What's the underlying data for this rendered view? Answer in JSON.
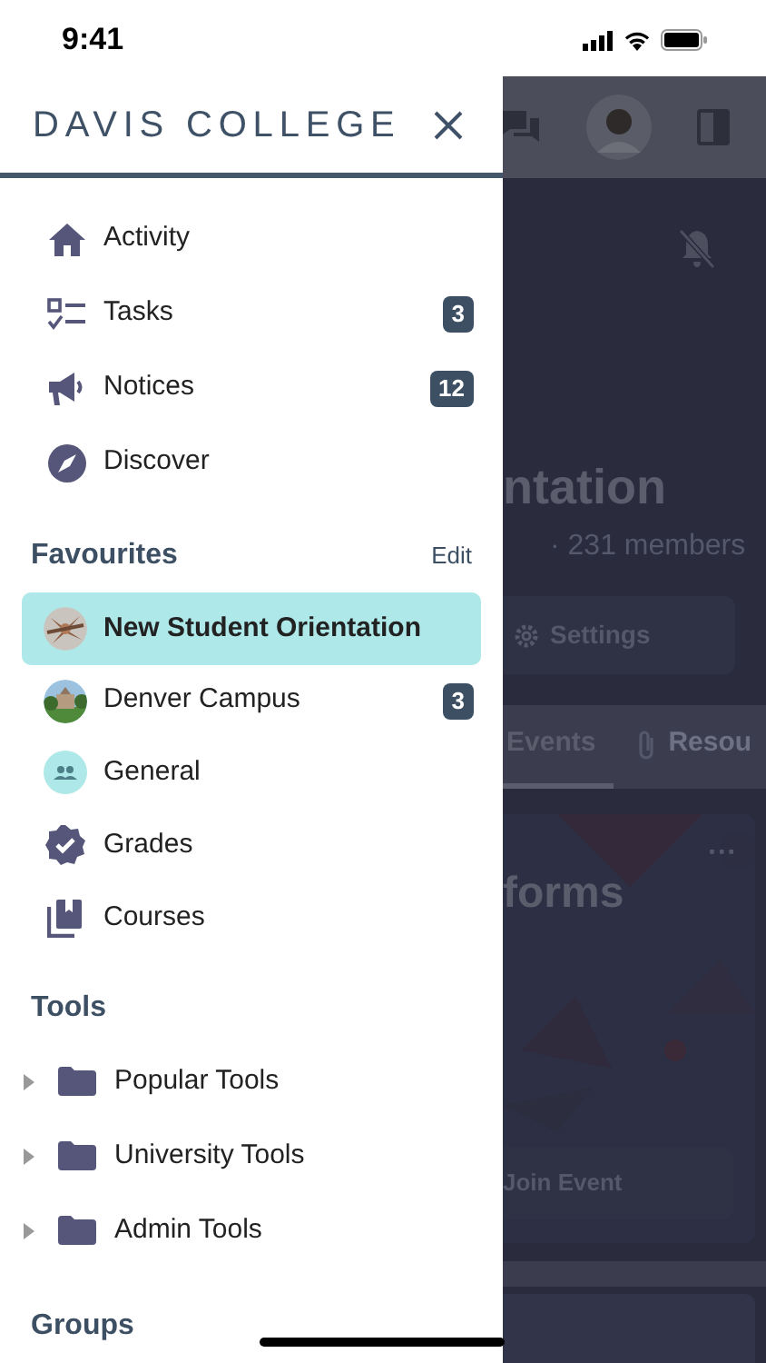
{
  "status_bar": {
    "time": "9:41"
  },
  "drawer": {
    "title": "DAVIS COLLEGE",
    "nav_items": [
      {
        "label": "Activity"
      },
      {
        "label": "Tasks",
        "badge": "3"
      },
      {
        "label": "Notices",
        "badge": "12"
      },
      {
        "label": "Discover"
      }
    ],
    "favourites": {
      "title": "Favourites",
      "action": "Edit",
      "items": [
        {
          "label": "New Student Orientation",
          "selected": true,
          "kind": "picture"
        },
        {
          "label": "Denver Campus",
          "selected": false,
          "kind": "picture",
          "badge": "3"
        },
        {
          "label": "General",
          "selected": false,
          "kind": "avatar"
        },
        {
          "label": "Grades",
          "selected": false,
          "kind": "icon"
        },
        {
          "label": "Courses",
          "selected": false,
          "kind": "icon"
        }
      ]
    },
    "tools": {
      "title": "Tools",
      "items": [
        {
          "label": "Popular Tools",
          "expanded": false
        },
        {
          "label": "University Tools",
          "expanded": false
        },
        {
          "label": "Admin Tools",
          "expanded": false
        }
      ]
    },
    "groups": {
      "title": "Groups"
    }
  },
  "background_page": {
    "title": "ntation",
    "meta": "· 231 members",
    "settings_button": "Settings",
    "tabs": [
      {
        "label": "Events",
        "selected": true
      },
      {
        "label": "Resou",
        "selected": false
      }
    ],
    "card": {
      "title": "forms",
      "more": "···",
      "button": "Join Event"
    }
  }
}
